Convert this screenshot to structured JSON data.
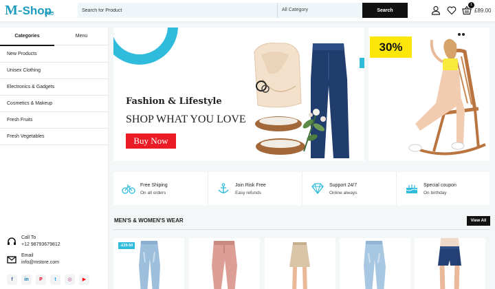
{
  "header": {
    "logo_main": "M",
    "logo_dash": "-",
    "logo_shop": "Shop",
    "logo_pro": "PRO",
    "search_placeholder": "Search for Product",
    "category_select": "All Category",
    "search_button": "Search",
    "cart_count": "1",
    "cart_total": "£89.00",
    "icons": [
      "user-icon",
      "heart-icon",
      "cart-icon"
    ]
  },
  "sidebar": {
    "tabs": [
      {
        "label": "Categories",
        "active": true
      },
      {
        "label": "Menu",
        "active": false
      }
    ],
    "categories": [
      "New Products",
      "Unisex Clothing",
      "Electronics & Gadgets",
      "Cosmetics & Makeup",
      "Fresh Fruits",
      "Fresh Vegetables"
    ],
    "contact": {
      "call_label": "Call To",
      "call_value": "+12 98793679812",
      "email_label": "Email",
      "email_value": "info@mstore.com"
    },
    "socials": [
      {
        "name": "facebook-icon",
        "glyph": "f",
        "color": "#3b5998"
      },
      {
        "name": "linkedin-icon",
        "glyph": "in",
        "color": "#0077b5"
      },
      {
        "name": "pinterest-icon",
        "glyph": "P",
        "color": "#e60023"
      },
      {
        "name": "twitter-icon",
        "glyph": "t",
        "color": "#1da1f2"
      },
      {
        "name": "instagram-icon",
        "glyph": "◎",
        "color": "#c13584"
      },
      {
        "name": "youtube-icon",
        "glyph": "▶",
        "color": "#ff0000"
      }
    ]
  },
  "hero": {
    "title": "Fashion & Lifestyle",
    "subtitle": "SHOP WHAT YOU LOVE",
    "button": "Buy Now",
    "accent_color": "#2fbbdc",
    "button_color": "#ea1b25"
  },
  "promo": {
    "badge": "30%",
    "badge_color": "#fde60a"
  },
  "features": [
    {
      "icon": "bicycle-icon",
      "title": "Free Shiping",
      "sub": "On all orders"
    },
    {
      "icon": "anchor-icon",
      "title": "Join Risk Free",
      "sub": "Easy refunds"
    },
    {
      "icon": "diamond-icon",
      "title": "Support 24/7",
      "sub": "Online always"
    },
    {
      "icon": "cake-icon",
      "title": "Special coupon",
      "sub": "On birthday"
    }
  ],
  "section": {
    "title": "MEN'S & WOMEN'S WEAR",
    "view_all": "View All"
  },
  "products": [
    {
      "image": "light-jeans",
      "price_tag": "-£29.50"
    },
    {
      "image": "pink-joggers",
      "price_tag": ""
    },
    {
      "image": "beige-skirt",
      "price_tag": ""
    },
    {
      "image": "light-jeans-2",
      "price_tag": ""
    },
    {
      "image": "denim-shorts",
      "price_tag": ""
    }
  ]
}
